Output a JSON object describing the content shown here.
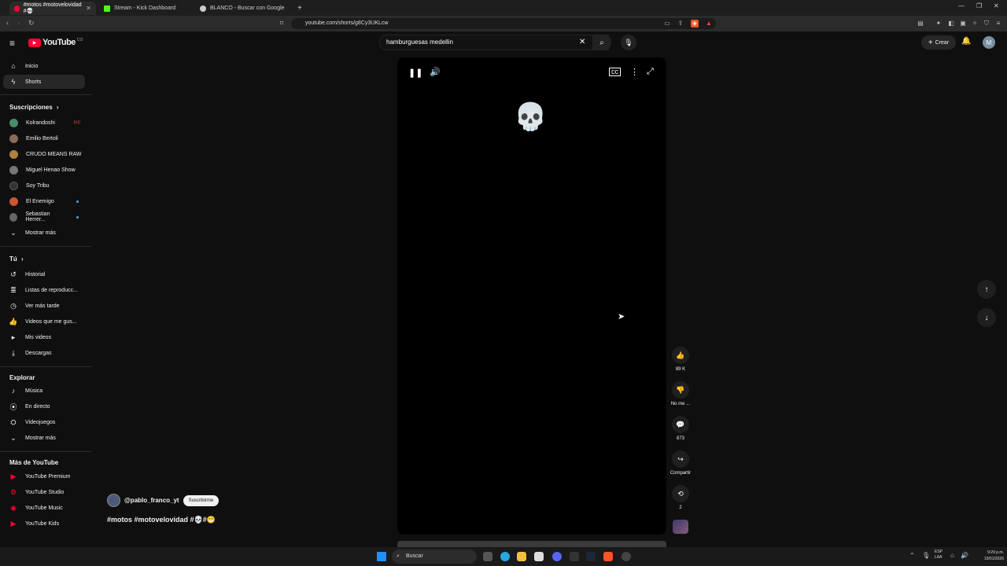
{
  "browser": {
    "tabs": [
      {
        "title": "#motos #motovelovidad #💀",
        "active": true,
        "color": "#ff0033"
      },
      {
        "title": "Stream - Kick Dashboard",
        "active": false,
        "color": "#53fc18"
      },
      {
        "title": "BLANCO - Buscar con Google",
        "active": false,
        "color": "#cccccc"
      }
    ],
    "url": "youtube.com/shorts/g8Cy3UKLcw",
    "new_tab": "+"
  },
  "youtube": {
    "logo_text": "YouTube",
    "country": "CO",
    "search_value": "hamburguesas medellin",
    "create_label": "Crear",
    "avatar_letter": "M"
  },
  "sidebar": {
    "main": [
      {
        "label": "Inicio",
        "icon": "home-icon"
      },
      {
        "label": "Shorts",
        "icon": "shorts-icon"
      }
    ],
    "subs_title": "Suscripciones",
    "subs": [
      {
        "label": "Kolrandoshi",
        "color": "#4a8c6a",
        "live": true
      },
      {
        "label": "Emilio Bertoli",
        "color": "#8a6a5a",
        "live": false
      },
      {
        "label": "CRUDO MEANS RAW",
        "color": "#b08040",
        "live": false
      },
      {
        "label": "Miguel Henao Show",
        "color": "#777777",
        "live": false
      },
      {
        "label": "Soy Tribu",
        "color": "#333333",
        "live": false
      },
      {
        "label": "El Enemigo",
        "color": "#cc5533",
        "live": true
      },
      {
        "label": "Sebastian Herrer...",
        "color": "#666666",
        "live": true
      }
    ],
    "show_more": "Mostrar más",
    "you_title": "Tú",
    "you": [
      {
        "label": "Historial",
        "icon": "history-icon"
      },
      {
        "label": "Listas de reproducc...",
        "icon": "playlist-icon"
      },
      {
        "label": "Ver más tarde",
        "icon": "clock-icon"
      },
      {
        "label": "Videos que me gus...",
        "icon": "thumbs-up-icon"
      },
      {
        "label": "Mis videos",
        "icon": "my-videos-icon"
      },
      {
        "label": "Descargas",
        "icon": "download-icon"
      }
    ],
    "explore_title": "Explorar",
    "explore": [
      {
        "label": "Música",
        "icon": "music-icon"
      },
      {
        "label": "En directo",
        "icon": "live-icon"
      },
      {
        "label": "Videojuegos",
        "icon": "gamepad-icon"
      },
      {
        "label": "Mostrar más",
        "icon": "chevron-down-icon"
      }
    ],
    "more_title": "Más de YouTube",
    "more": [
      {
        "label": "YouTube Premium"
      },
      {
        "label": "YouTube Studio"
      },
      {
        "label": "YouTube Music"
      },
      {
        "label": "YouTube Kids"
      }
    ]
  },
  "short": {
    "emoji": "💀",
    "channel": "@pablo_franco_yt",
    "subscribe": "Suscribirme",
    "title": "#motos #motovelovidad #💀#😁",
    "actions": [
      {
        "label": "89 K",
        "icon": "like-icon"
      },
      {
        "label": "No me ...",
        "icon": "dislike-icon"
      },
      {
        "label": "873",
        "icon": "comment-icon"
      },
      {
        "label": "Compartir",
        "icon": "share-icon"
      },
      {
        "label": "2",
        "icon": "remix-icon"
      }
    ]
  },
  "taskbar": {
    "search": "Buscar",
    "lang": "ESP\nLAA",
    "time": "9:29 p.m.",
    "date": "19/01/2026"
  }
}
